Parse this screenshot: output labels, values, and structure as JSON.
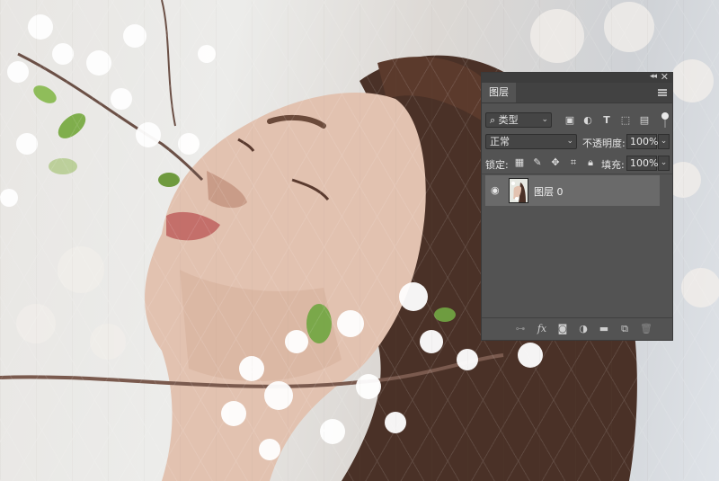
{
  "panel": {
    "tab_label": "图层",
    "filter": {
      "selected": "类型"
    },
    "blend_mode": {
      "selected": "正常"
    },
    "opacity": {
      "label": "不透明度:",
      "value": "100%"
    },
    "lock": {
      "label": "锁定:"
    },
    "fill": {
      "label": "填充:",
      "value": "100%"
    },
    "layers": [
      {
        "name": "图层 0",
        "visible": true,
        "selected": true
      }
    ]
  },
  "icons": {
    "panel_header": [
      "collapse-icon",
      "close-icon"
    ],
    "filters": [
      "pixel-filter-icon",
      "adjustment-filter-icon",
      "type-filter-icon",
      "shape-filter-icon",
      "smart-object-filter-icon"
    ],
    "locks": [
      "lock-transparent-icon",
      "lock-pixels-icon",
      "lock-position-icon",
      "lock-artboard-icon",
      "lock-all-icon"
    ],
    "footer": [
      "link-icon",
      "fx-icon",
      "mask-icon",
      "adjustment-icon",
      "group-icon",
      "new-layer-icon",
      "delete-icon"
    ]
  },
  "colors": {
    "panel_bg": "#535353",
    "selected_layer_bg": "#6a6a6a",
    "input_bg": "#454545"
  }
}
